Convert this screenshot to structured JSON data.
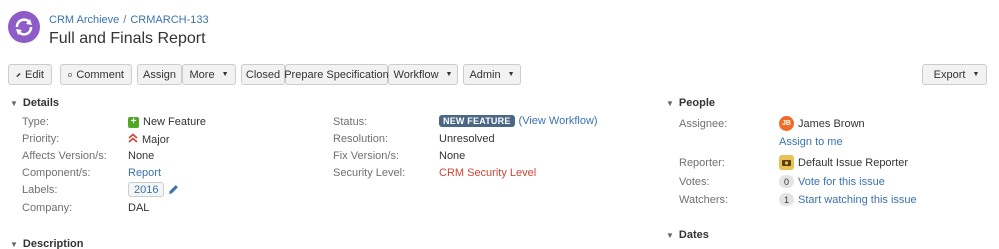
{
  "breadcrumb": {
    "project": "CRM Archieve",
    "separator": "/",
    "issue_key": "CRMARCH-133"
  },
  "issue": {
    "title": "Full and Finals Report"
  },
  "toolbar": {
    "edit": "Edit",
    "comment": "Comment",
    "assign": "Assign",
    "more": "More",
    "closed": "Closed",
    "prepare": "Prepare Specification",
    "workflow": "Workflow",
    "admin": "Admin",
    "export": "Export"
  },
  "details": {
    "heading": "Details",
    "type_label": "Type:",
    "type_value": "New Feature",
    "priority_label": "Priority:",
    "priority_value": "Major",
    "affects_label": "Affects Version/s:",
    "affects_value": "None",
    "component_label": "Component/s:",
    "component_value": "Report",
    "labels_label": "Labels:",
    "labels_value": "2016",
    "company_label": "Company:",
    "company_value": "DAL",
    "status_label": "Status:",
    "status_value": "NEW FEATURE",
    "status_link": "(View Workflow)",
    "resolution_label": "Resolution:",
    "resolution_value": "Unresolved",
    "fix_label": "Fix Version/s:",
    "fix_value": "None",
    "security_label": "Security Level:",
    "security_value": "CRM Security Level"
  },
  "people": {
    "heading": "People",
    "assignee_label": "Assignee:",
    "assignee_value": "James Brown",
    "assignee_initials": "JB",
    "assign_to_me": "Assign to me",
    "reporter_label": "Reporter:",
    "reporter_value": "Default Issue Reporter",
    "votes_label": "Votes:",
    "votes_count": "0",
    "votes_link": "Vote for this issue",
    "watchers_label": "Watchers:",
    "watchers_count": "1",
    "watchers_link": "Start watching this issue"
  },
  "description": {
    "heading": "Description"
  },
  "dates": {
    "heading": "Dates"
  },
  "colors": {
    "link": "#3b73af",
    "status": "#4a6785",
    "security": "#d04437",
    "avatar": "#8e5cc7"
  }
}
